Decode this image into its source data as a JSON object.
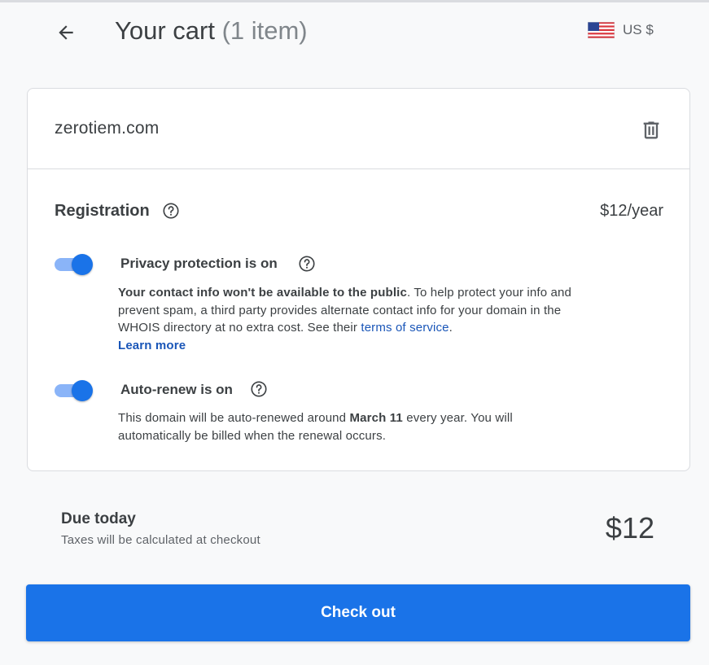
{
  "header": {
    "back_icon": "arrow-left-icon",
    "title": "Your cart",
    "item_count": "(1 item)",
    "currency_label": "US $",
    "flag_icon": "us-flag-icon"
  },
  "cart": {
    "domain": "zerotiem.com",
    "delete_icon": "trash-icon",
    "registration_label": "Registration",
    "registration_price": "$12/year",
    "privacy": {
      "title": "Privacy protection is on",
      "enabled": true,
      "desc_bold": "Your contact info won't be available to the public",
      "desc_text": ". To help protect your info and prevent spam, a third party provides alternate contact info for your domain in the WHOIS directory at no extra cost. See their ",
      "terms_link": "terms of service",
      "desc_end": ".",
      "learn_more": "Learn more"
    },
    "autorenew": {
      "title": "Auto-renew is on",
      "enabled": true,
      "desc_pre": "This domain will be auto-renewed around ",
      "desc_date": "March 11",
      "desc_post": " every year. You will automatically be billed when the renewal occurs."
    }
  },
  "summary": {
    "due_label": "Due today",
    "tax_note": "Taxes will be calculated at checkout",
    "amount": "$12"
  },
  "checkout_label": "Check out",
  "colors": {
    "primary": "#1a73e8",
    "toggle_track": "#8ab4f8",
    "link": "#1a56b8",
    "text": "#3c4043",
    "background": "#f8f9fa"
  }
}
